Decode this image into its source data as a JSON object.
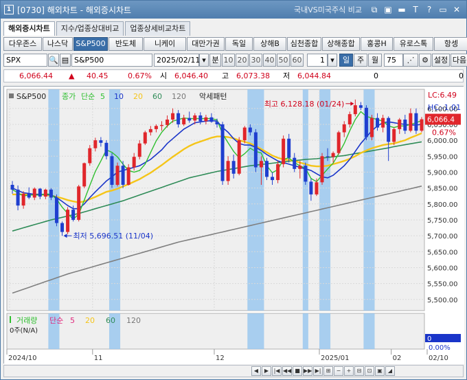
{
  "window": {
    "app_number": "1",
    "title": "[0730] 해외차트 - 해외증시차트",
    "compare_label": "국내VS미국주식 비교",
    "toolbar_icons": [
      "link-icon",
      "window-icon",
      "minimize-icon",
      "text-icon",
      "help-icon",
      "restore-icon",
      "close-icon"
    ],
    "toolbar_glyphs": [
      "⧉",
      "▣",
      "▬",
      "T",
      "?",
      "▭",
      "✕"
    ]
  },
  "tabs": [
    {
      "label": "해외증시차트",
      "active": true
    },
    {
      "label": "지수/업종상대비교",
      "active": false
    },
    {
      "label": "업종상세비교차트",
      "active": false
    }
  ],
  "indices": [
    {
      "label": "다우존스",
      "w": 56
    },
    {
      "label": "나스닥",
      "w": 44
    },
    {
      "label": "S&P500",
      "w": 50,
      "active": true
    },
    {
      "label": "반도체",
      "w": 50
    },
    {
      "label": "니케이",
      "w": 62
    },
    {
      "label": "대만가권",
      "w": 55
    },
    {
      "label": "독일",
      "w": 40
    },
    {
      "label": "상해B",
      "w": 48
    },
    {
      "label": "심천종합",
      "w": 50
    },
    {
      "label": "상해종합",
      "w": 55
    },
    {
      "label": "홍콩H",
      "w": 47
    },
    {
      "label": "유로스톡",
      "w": 58
    },
    {
      "label": "항셍",
      "w": 50
    }
  ],
  "controls": {
    "symbol": "SPX",
    "symbol_name": "S&P500",
    "date": "2025/02/11",
    "unit_label": "분",
    "minute_options": [
      "10",
      "20",
      "30",
      "40",
      "50",
      "60"
    ],
    "count": "1",
    "periods": [
      {
        "label": "일",
        "selected": true
      },
      {
        "label": "주",
        "selected": false
      },
      {
        "label": "월",
        "selected": false
      }
    ],
    "display_count": "75",
    "settings_label": "설정",
    "next_label": "다음"
  },
  "info": {
    "price": "6,066.44",
    "change_arrow": "▲",
    "change": "40.45",
    "change_pct": "0.67%",
    "open_label": "시",
    "open": "6,046.40",
    "high_label": "고",
    "high": "6,073.38",
    "low_label": "저",
    "low": "6,044.84",
    "volume1": "0",
    "volume2": "0"
  },
  "chart_data": {
    "type": "candlestick",
    "title": "S&P500",
    "legend": [
      {
        "label": "종가",
        "color": "#2fbf2f"
      },
      {
        "label": "단순",
        "color": "#2fbf2f"
      },
      {
        "label": "5",
        "color": "#2fbf2f"
      },
      {
        "label": "10",
        "color": "#1a35c9"
      },
      {
        "label": "20",
        "color": "#f5c518"
      },
      {
        "label": "60",
        "color": "#2e8b57"
      },
      {
        "label": "120",
        "color": "#777777"
      }
    ],
    "pattern_label": "악세패턴",
    "lc_label": "LC:6.49",
    "hc_label": "HC:-1.01",
    "current_price_label": "6,066.4",
    "current_change_label": "0.67%",
    "high_annotation": "최고 6,128.18 (01/24)",
    "low_annotation": "최저 5,696.51 (11/04)",
    "y_ticks": [
      "6,100.00",
      "6,050.00",
      "6,000.00",
      "5,950.00",
      "5,900.00",
      "5,850.00",
      "5,800.00",
      "5,750.00",
      "5,700.00",
      "5,650.00",
      "5,600.00",
      "5,550.00",
      "5,500.00"
    ],
    "y_values": [
      6100,
      6050,
      6000,
      5950,
      5900,
      5850,
      5800,
      5750,
      5700,
      5650,
      5600,
      5550,
      5500
    ],
    "ylim": [
      5465,
      6160
    ],
    "x_labels": [
      "2024/10",
      "11",
      "12",
      "2025/01",
      "02",
      "02/10"
    ],
    "candles": [
      {
        "o": 5860,
        "h": 5872,
        "l": 5832,
        "c": 5845
      },
      {
        "o": 5845,
        "h": 5858,
        "l": 5780,
        "c": 5795
      },
      {
        "o": 5795,
        "h": 5840,
        "l": 5785,
        "c": 5832
      },
      {
        "o": 5832,
        "h": 5852,
        "l": 5815,
        "c": 5820
      },
      {
        "o": 5820,
        "h": 5852,
        "l": 5812,
        "c": 5848
      },
      {
        "o": 5848,
        "h": 5850,
        "l": 5815,
        "c": 5823
      },
      {
        "o": 5823,
        "h": 5848,
        "l": 5815,
        "c": 5845
      },
      {
        "o": 5845,
        "h": 5850,
        "l": 5812,
        "c": 5820
      },
      {
        "o": 5820,
        "h": 5830,
        "l": 5730,
        "c": 5740
      },
      {
        "o": 5740,
        "h": 5745,
        "l": 5700,
        "c": 5712
      },
      {
        "o": 5712,
        "h": 5790,
        "l": 5705,
        "c": 5782
      },
      {
        "o": 5782,
        "h": 5795,
        "l": 5745,
        "c": 5750
      },
      {
        "o": 5750,
        "h": 5860,
        "l": 5745,
        "c": 5855
      },
      {
        "o": 5855,
        "h": 5930,
        "l": 5850,
        "c": 5928
      },
      {
        "o": 5928,
        "h": 5985,
        "l": 5920,
        "c": 5975
      },
      {
        "o": 5975,
        "h": 6008,
        "l": 5965,
        "c": 6000
      },
      {
        "o": 6000,
        "h": 6010,
        "l": 5980,
        "c": 5992
      },
      {
        "o": 5992,
        "h": 6000,
        "l": 5940,
        "c": 5950
      },
      {
        "o": 5950,
        "h": 5960,
        "l": 5850,
        "c": 5860
      },
      {
        "o": 5860,
        "h": 5930,
        "l": 5855,
        "c": 5920
      },
      {
        "o": 5920,
        "h": 5935,
        "l": 5850,
        "c": 5860
      },
      {
        "o": 5860,
        "h": 5925,
        "l": 5858,
        "c": 5915
      },
      {
        "o": 5915,
        "h": 5960,
        "l": 5905,
        "c": 5948
      },
      {
        "o": 5948,
        "h": 6000,
        "l": 5940,
        "c": 5990
      },
      {
        "o": 5990,
        "h": 6030,
        "l": 5985,
        "c": 6025
      },
      {
        "o": 6025,
        "h": 6045,
        "l": 6015,
        "c": 6035
      },
      {
        "o": 6035,
        "h": 6050,
        "l": 6025,
        "c": 6045
      },
      {
        "o": 6045,
        "h": 6060,
        "l": 6030,
        "c": 6048
      },
      {
        "o": 6048,
        "h": 6078,
        "l": 6040,
        "c": 6065
      },
      {
        "o": 6065,
        "h": 6100,
        "l": 6055,
        "c": 6085
      },
      {
        "o": 6085,
        "h": 6095,
        "l": 6040,
        "c": 6050
      },
      {
        "o": 6050,
        "h": 6080,
        "l": 6045,
        "c": 6070
      },
      {
        "o": 6070,
        "h": 6090,
        "l": 6055,
        "c": 6062
      },
      {
        "o": 6062,
        "h": 6085,
        "l": 6050,
        "c": 6078
      },
      {
        "o": 6078,
        "h": 6088,
        "l": 6050,
        "c": 6060
      },
      {
        "o": 6060,
        "h": 6080,
        "l": 6050,
        "c": 6072
      },
      {
        "o": 6072,
        "h": 6085,
        "l": 6055,
        "c": 6058
      },
      {
        "o": 6058,
        "h": 6068,
        "l": 6040,
        "c": 6050
      },
      {
        "o": 6050,
        "h": 6058,
        "l": 5860,
        "c": 5872
      },
      {
        "o": 5872,
        "h": 5950,
        "l": 5860,
        "c": 5935
      },
      {
        "o": 5935,
        "h": 5955,
        "l": 5880,
        "c": 5895
      },
      {
        "o": 5895,
        "h": 6010,
        "l": 5890,
        "c": 6000
      },
      {
        "o": 6000,
        "h": 6045,
        "l": 5990,
        "c": 6040
      },
      {
        "o": 6040,
        "h": 6050,
        "l": 6015,
        "c": 6025
      },
      {
        "o": 6025,
        "h": 6035,
        "l": 5900,
        "c": 5915
      },
      {
        "o": 5915,
        "h": 5950,
        "l": 5860,
        "c": 5935
      },
      {
        "o": 5935,
        "h": 5945,
        "l": 5875,
        "c": 5885
      },
      {
        "o": 5885,
        "h": 5900,
        "l": 5860,
        "c": 5875
      },
      {
        "o": 5875,
        "h": 5935,
        "l": 5865,
        "c": 5925
      },
      {
        "o": 5925,
        "h": 6015,
        "l": 5915,
        "c": 6005
      },
      {
        "o": 6005,
        "h": 6020,
        "l": 5930,
        "c": 5945
      },
      {
        "o": 5945,
        "h": 5960,
        "l": 5900,
        "c": 5910
      },
      {
        "o": 5910,
        "h": 5935,
        "l": 5880,
        "c": 5920
      },
      {
        "o": 5920,
        "h": 5930,
        "l": 5860,
        "c": 5870
      },
      {
        "o": 5870,
        "h": 5880,
        "l": 5810,
        "c": 5830
      },
      {
        "o": 5830,
        "h": 5880,
        "l": 5825,
        "c": 5868
      },
      {
        "o": 5868,
        "h": 5960,
        "l": 5860,
        "c": 5950
      },
      {
        "o": 5950,
        "h": 5975,
        "l": 5935,
        "c": 5948
      },
      {
        "o": 5948,
        "h": 5965,
        "l": 5930,
        "c": 5960
      },
      {
        "o": 5960,
        "h": 6030,
        "l": 5955,
        "c": 6025
      },
      {
        "o": 6025,
        "h": 6060,
        "l": 6010,
        "c": 6050
      },
      {
        "o": 6050,
        "h": 6090,
        "l": 6040,
        "c": 6082
      },
      {
        "o": 6082,
        "h": 6128,
        "l": 6075,
        "c": 6110
      },
      {
        "o": 6110,
        "h": 6120,
        "l": 6095,
        "c": 6102
      },
      {
        "o": 6102,
        "h": 6110,
        "l": 6000,
        "c": 6010
      },
      {
        "o": 6010,
        "h": 6080,
        "l": 6000,
        "c": 6070
      },
      {
        "o": 6070,
        "h": 6085,
        "l": 6030,
        "c": 6040
      },
      {
        "o": 6040,
        "h": 6080,
        "l": 6025,
        "c": 6070
      },
      {
        "o": 6070,
        "h": 6075,
        "l": 5935,
        "c": 5995
      },
      {
        "o": 5995,
        "h": 6040,
        "l": 5985,
        "c": 6035
      },
      {
        "o": 6035,
        "h": 6070,
        "l": 6020,
        "c": 6065
      },
      {
        "o": 6065,
        "h": 6080,
        "l": 6020,
        "c": 6030
      },
      {
        "o": 6030,
        "h": 6100,
        "l": 6025,
        "c": 6085
      },
      {
        "o": 6085,
        "h": 6100,
        "l": 6020,
        "c": 6030
      },
      {
        "o": 6030,
        "h": 6073,
        "l": 6025,
        "c": 6066
      }
    ],
    "ma5": [
      5845,
      5835,
      5825,
      5828,
      5828,
      5828,
      5832,
      5830,
      5815,
      5790,
      5770,
      5752,
      5768,
      5812,
      5858,
      5902,
      5935,
      5970,
      5962,
      5948,
      5925,
      5905,
      5900,
      5905,
      5925,
      5962,
      5998,
      6025,
      6045,
      6060,
      6065,
      6070,
      6068,
      6068,
      6068,
      6068,
      6068,
      6064,
      6020,
      5992,
      5965,
      5945,
      5958,
      5975,
      5965,
      5960,
      5920,
      5898,
      5908,
      5940,
      5945,
      5930,
      5920,
      5912,
      5880,
      5870,
      5890,
      5910,
      5928,
      5958,
      5990,
      6030,
      6065,
      6090,
      6075,
      6070,
      6065,
      6060,
      6045,
      6040,
      6045,
      6045,
      6050,
      6055,
      6062
    ],
    "ma10": [
      5850,
      5842,
      5835,
      5833,
      5830,
      5830,
      5830,
      5828,
      5820,
      5808,
      5795,
      5785,
      5785,
      5800,
      5820,
      5838,
      5855,
      5872,
      5885,
      5900,
      5905,
      5910,
      5915,
      5920,
      5930,
      5940,
      5955,
      5970,
      5990,
      6005,
      6020,
      6035,
      6045,
      6055,
      6058,
      6060,
      6062,
      6060,
      6040,
      6025,
      6005,
      5990,
      5985,
      5985,
      5978,
      5968,
      5955,
      5945,
      5935,
      5930,
      5925,
      5920,
      5915,
      5910,
      5905,
      5895,
      5885,
      5882,
      5890,
      5905,
      5920,
      5940,
      5965,
      5990,
      6010,
      6030,
      6045,
      6055,
      6058,
      6055,
      6052,
      6050,
      6048,
      6048,
      6050
    ],
    "ma20": [
      5830,
      5830,
      5830,
      5830,
      5830,
      5830,
      5828,
      5826,
      5822,
      5818,
      5812,
      5808,
      5805,
      5808,
      5815,
      5822,
      5830,
      5838,
      5842,
      5848,
      5855,
      5862,
      5870,
      5878,
      5888,
      5898,
      5910,
      5922,
      5935,
      5948,
      5960,
      5972,
      5982,
      5990,
      5996,
      6002,
      6008,
      6012,
      6012,
      6010,
      6006,
      6000,
      5995,
      5990,
      5982,
      5972,
      5962,
      5952,
      5945,
      5940,
      5938,
      5935,
      5930,
      5925,
      5920,
      5918,
      5918,
      5920,
      5925,
      5930,
      5935,
      5942,
      5950,
      5960,
      5968,
      5975,
      5980,
      5985,
      5988,
      5990,
      5995,
      6000,
      6008,
      6015,
      6022
    ],
    "ma60": [
      5715,
      5720,
      5725,
      5730,
      5735,
      5740,
      5745,
      5750,
      5754,
      5758,
      5762,
      5766,
      5770,
      5775,
      5780,
      5785,
      5790,
      5795,
      5800,
      5805,
      5810,
      5816,
      5822,
      5828,
      5834,
      5840,
      5846,
      5852,
      5858,
      5864,
      5870,
      5876,
      5882,
      5886,
      5890,
      5894,
      5898,
      5902,
      5905,
      5908,
      5911,
      5914,
      5917,
      5920,
      5922,
      5924,
      5926,
      5928,
      5930,
      5932,
      5934,
      5936,
      5938,
      5940,
      5941,
      5942,
      5944,
      5946,
      5948,
      5950,
      5952,
      5955,
      5958,
      5961,
      5964,
      5967,
      5970,
      5973,
      5976,
      5980,
      5983,
      5986,
      5989,
      5992,
      5995
    ],
    "ma120": [
      5520,
      5526,
      5532,
      5538,
      5544,
      5550,
      5556,
      5562,
      5568,
      5574,
      5580,
      5585,
      5590,
      5595,
      5600,
      5605,
      5610,
      5615,
      5620,
      5625,
      5630,
      5635,
      5640,
      5645,
      5650,
      5655,
      5660,
      5665,
      5670,
      5675,
      5680,
      5684,
      5688,
      5692,
      5696,
      5700,
      5704,
      5708,
      5712,
      5716,
      5720,
      5724,
      5728,
      5732,
      5736,
      5740,
      5744,
      5748,
      5752,
      5756,
      5760,
      5764,
      5768,
      5772,
      5776,
      5780,
      5784,
      5788,
      5792,
      5796,
      5800,
      5804,
      5808,
      5812,
      5816,
      5820,
      5824,
      5828,
      5832,
      5836,
      5840,
      5844,
      5848,
      5852,
      5856
    ],
    "pattern_bands": [
      [
        7,
        8
      ],
      [
        18,
        19
      ],
      [
        43,
        45
      ],
      [
        53,
        53
      ],
      [
        56,
        57
      ],
      [
        64,
        65
      ]
    ],
    "volume_legend": [
      {
        "label": "거래량",
        "color": "#2fbf2f"
      },
      {
        "label": "단순",
        "color": "#e0287d"
      },
      {
        "label": "5",
        "color": "#e0287d"
      },
      {
        "label": "20",
        "color": "#f5c518"
      },
      {
        "label": "60",
        "color": "#2e8b57"
      },
      {
        "label": "120",
        "color": "#777777"
      }
    ],
    "volume_unit": "0주(N/A)",
    "volume_current": "0",
    "volume_pct": "0.00%"
  },
  "colors": {
    "up": "#e0262b",
    "down": "#1f3fcf",
    "band": "#9bc8ee",
    "grid": "#d9d9d9",
    "active_button": "#3a6ea8"
  },
  "bottom_nav": [
    "◀",
    "▶",
    "|◀",
    "◀◀",
    "■",
    "▶▶",
    "▶|",
    "⊞",
    "−",
    "+",
    "⊟",
    "⊡",
    "▣",
    "◢"
  ]
}
